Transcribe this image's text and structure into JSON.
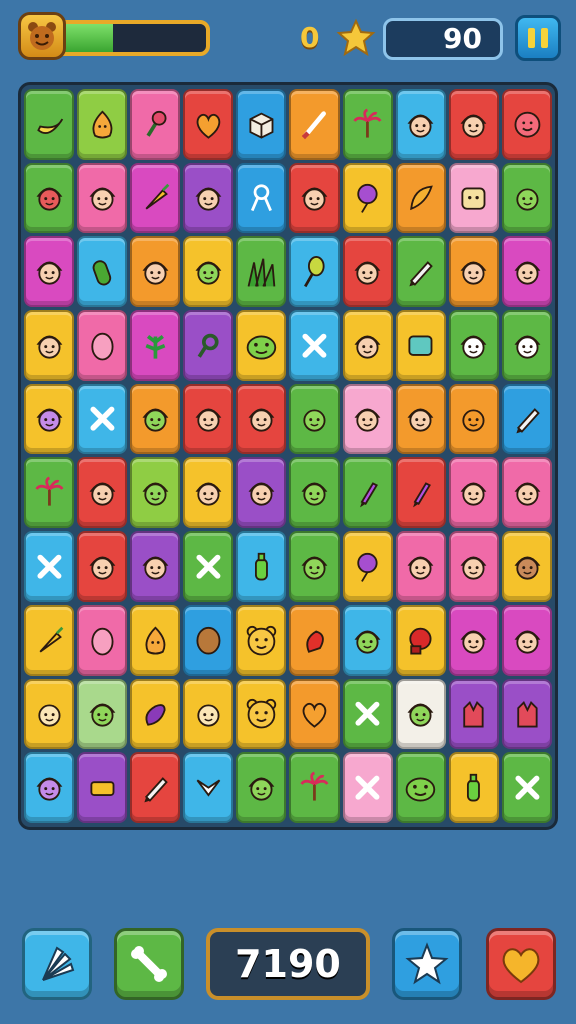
{
  "hud": {
    "avatar_icon": "bear-face-icon",
    "level_progress": 0.38,
    "coins": "0",
    "coin_icon": "gold-star-coin-icon",
    "score": "90",
    "pause_icon": "pause-icon"
  },
  "colors": {
    "background": "#3d76a8",
    "accent_gold": "#f5c73a",
    "board_bg": "#274a68"
  },
  "board": {
    "rows": 10,
    "cols": 10,
    "tiles": [
      [
        "banana",
        "onion",
        "broccoli",
        "heart",
        "crate",
        "brush",
        "palm",
        "girl",
        "girl",
        "smiley"
      ],
      [
        "devil",
        "girl",
        "carrot",
        "girl",
        "scissors",
        "girl",
        "balloon",
        "feather",
        "toaster",
        "alien"
      ],
      [
        "girl",
        "cucumber",
        "girl",
        "gnome",
        "grass",
        "spoon",
        "girl",
        "pencil",
        "girl",
        "girl"
      ],
      [
        "girl",
        "egg",
        "leaf",
        "ring",
        "frog",
        "cross",
        "girl",
        "screen",
        "ghost",
        "ghost"
      ],
      [
        "cat",
        "cross",
        "gnome",
        "girl",
        "girl",
        "alien",
        "girl",
        "girl",
        "fox",
        "pencil"
      ],
      [
        "palm",
        "girl",
        "gnome",
        "girl",
        "girl",
        "gnome",
        "marker",
        "marker",
        "girl",
        "girl"
      ],
      [
        "cross",
        "girl",
        "girl",
        "cross",
        "bottle",
        "gnome",
        "balloon",
        "girl",
        "girl",
        "boy"
      ],
      [
        "carrot",
        "egg",
        "onion",
        "potato",
        "bear",
        "pepper",
        "gnome",
        "boxing",
        "girl",
        "girl"
      ],
      [
        "face",
        "gnome",
        "eggplant",
        "face",
        "bear",
        "heart",
        "cross",
        "gnome",
        "glove",
        "glove"
      ],
      [
        "cat",
        "box",
        "pencil",
        "fish",
        "gnome",
        "palm",
        "cross",
        "frog",
        "bottle",
        "cross"
      ]
    ]
  },
  "bottom": {
    "powerups": [
      {
        "name": "leaf-fan-icon",
        "color": "#3fb6e8"
      },
      {
        "name": "bone-icon",
        "color": "#5db845"
      },
      {
        "name": "star-icon",
        "color": "#2f9fe0"
      },
      {
        "name": "heart-icon",
        "color": "#e5453f"
      }
    ],
    "total_score": "7190"
  }
}
